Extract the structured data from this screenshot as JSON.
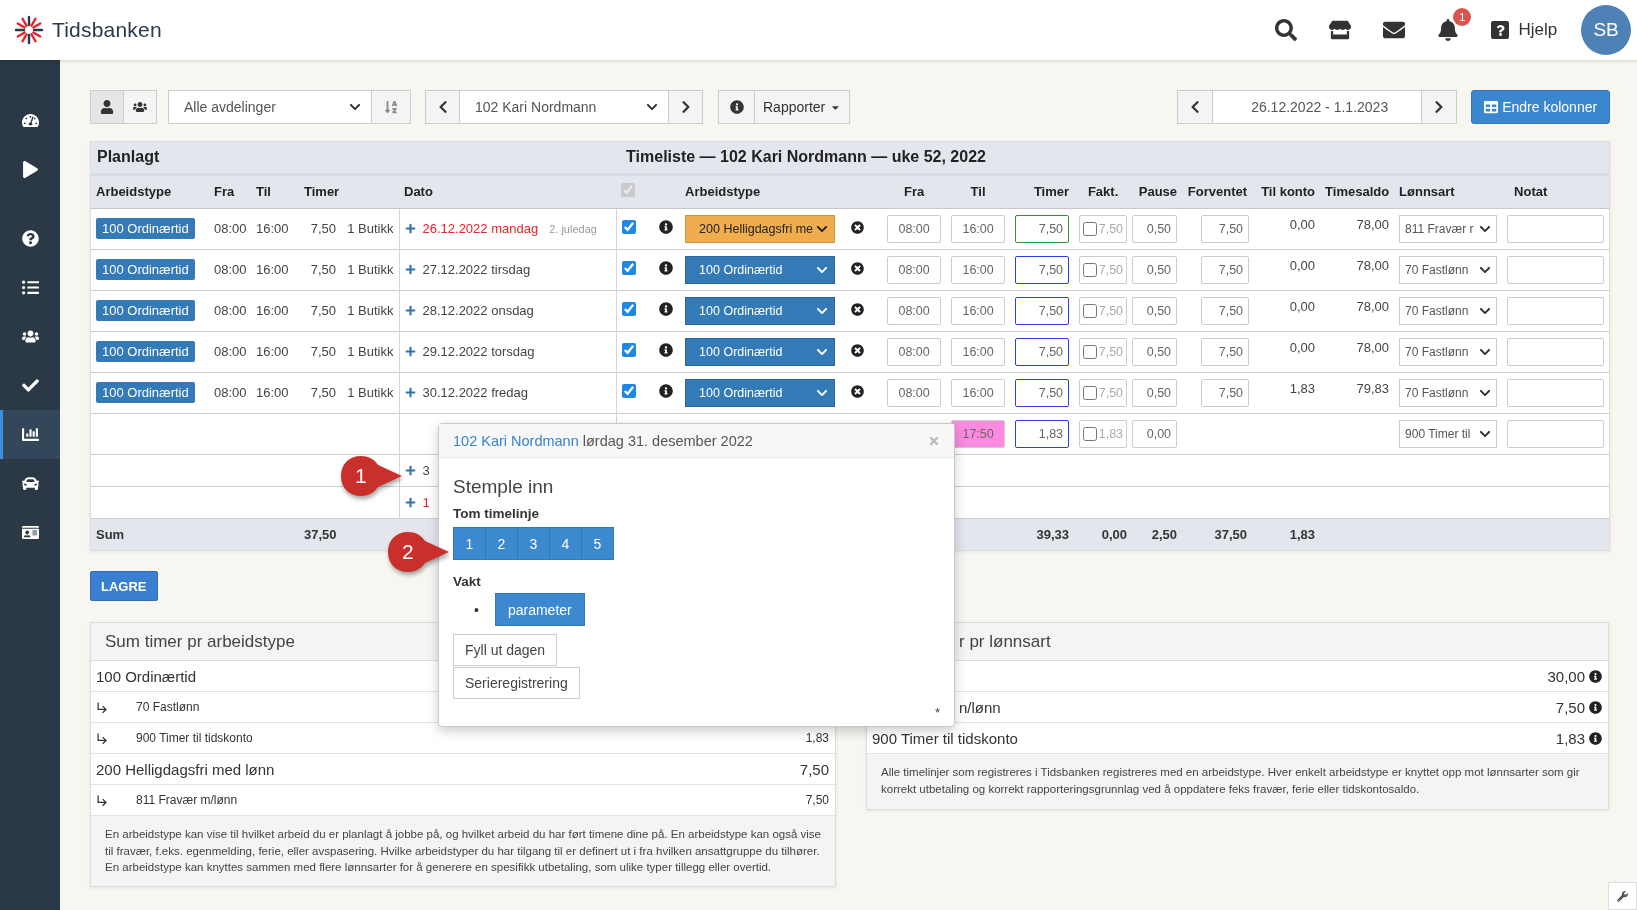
{
  "app": {
    "name": "Tidsbanken"
  },
  "topbar": {
    "notifications": "1",
    "help": "Hjelp",
    "avatar": "SB"
  },
  "sidebar": {
    "items": [
      {
        "selected": false
      },
      {
        "selected": false
      },
      {
        "selected": false
      },
      {
        "selected": false
      },
      {
        "selected": false
      },
      {
        "selected": false
      },
      {
        "selected": true
      },
      {
        "selected": false
      },
      {
        "selected": false
      }
    ]
  },
  "toolbar": {
    "department": "Alle avdelinger",
    "employee": "102 Kari Nordmann",
    "reports": "Rapporter",
    "period": "26.12.2022 - 1.1.2023",
    "columns_button": "Endre kolonner"
  },
  "timesheet": {
    "planned_title": "Planlagt",
    "title": "Timeliste — 102 Kari Nordmann — uke 52, 2022",
    "all_checked": true,
    "columns": [
      "Arbeidstype",
      "Fra",
      "Til",
      "Timer",
      "Dato",
      "Arbeidstype",
      "Fra",
      "Til",
      "Timer",
      "Fakt.",
      "Pause",
      "Forventet",
      "Til konto",
      "Timesaldo",
      "Lønnsart",
      "Notat"
    ],
    "rows": [
      {
        "kind": "full",
        "planned_type": "100 Ordinærtid",
        "planned_from": "08:00",
        "planned_to": "16:00",
        "planned_hours": "7,50",
        "department": "1 Butikk",
        "date": "26.12.2022 mandag",
        "date_note": "2. juledag",
        "holiday": true,
        "checked": true,
        "work_type": "200 Helligdagsfri me",
        "color": "#f0ad4e",
        "from": "08:00",
        "to": "16:00",
        "to_flagged": false,
        "hours": "7,50",
        "hours_confirmed": true,
        "billable_checked": false,
        "billable": "7,50",
        "pause": "0,50",
        "expected": "7,50",
        "to_account": "0,00",
        "balance": "78,00",
        "wage_type": "811 Fravær r"
      },
      {
        "kind": "full",
        "planned_type": "100 Ordinærtid",
        "planned_from": "08:00",
        "planned_to": "16:00",
        "planned_hours": "7,50",
        "department": "1 Butikk",
        "date": "27.12.2022 tirsdag",
        "holiday": false,
        "checked": true,
        "work_type": "100 Ordinærtid",
        "color": "#337ab7",
        "from": "08:00",
        "to": "16:00",
        "to_flagged": false,
        "hours": "7,50",
        "hours_confirmed": false,
        "billable_checked": false,
        "billable": "7,50",
        "pause": "0,50",
        "expected": "7,50",
        "to_account": "0,00",
        "balance": "78,00",
        "wage_type": "70 Fastlønn"
      },
      {
        "kind": "full",
        "planned_type": "100 Ordinærtid",
        "planned_from": "08:00",
        "planned_to": "16:00",
        "planned_hours": "7,50",
        "department": "1 Butikk",
        "date": "28.12.2022 onsdag",
        "holiday": false,
        "checked": true,
        "work_type": "100 Ordinærtid",
        "color": "#337ab7",
        "from": "08:00",
        "to": "16:00",
        "to_flagged": false,
        "hours": "7,50",
        "hours_confirmed": false,
        "billable_checked": false,
        "billable": "7,50",
        "pause": "0,50",
        "expected": "7,50",
        "to_account": "0,00",
        "balance": "78,00",
        "wage_type": "70 Fastlønn"
      },
      {
        "kind": "full",
        "planned_type": "100 Ordinærtid",
        "planned_from": "08:00",
        "planned_to": "16:00",
        "planned_hours": "7,50",
        "department": "1 Butikk",
        "date": "29.12.2022 torsdag",
        "holiday": false,
        "checked": true,
        "work_type": "100 Ordinærtid",
        "color": "#337ab7",
        "from": "08:00",
        "to": "16:00",
        "to_flagged": false,
        "hours": "7,50",
        "hours_confirmed": false,
        "billable_checked": false,
        "billable": "7,50",
        "pause": "0,50",
        "expected": "7,50",
        "to_account": "0,00",
        "balance": "78,00",
        "wage_type": "70 Fastlønn"
      },
      {
        "kind": "full",
        "planned_type": "100 Ordinærtid",
        "planned_from": "08:00",
        "planned_to": "16:00",
        "planned_hours": "7,50",
        "department": "1 Butikk",
        "date": "30.12.2022 fredag",
        "holiday": false,
        "checked": true,
        "work_type": "100 Ordinærtid",
        "color": "#337ab7",
        "from": "08:00",
        "to": "16:00",
        "to_flagged": false,
        "hours": "7,50",
        "hours_confirmed": false,
        "billable_checked": false,
        "billable": "7,50",
        "pause": "0,50",
        "expected": "7,50",
        "to_account": "1,83",
        "balance": "79,83",
        "wage_type": "70 Fastlønn"
      },
      {
        "kind": "covered",
        "to": "17:50",
        "to_flagged": true,
        "hours": "1,83",
        "hours_confirmed": false,
        "billable_checked": false,
        "billable": "1,83",
        "pause": "0,00",
        "wage_type": "900 Timer til"
      },
      {
        "kind": "stub",
        "date": "3",
        "holiday": false
      },
      {
        "kind": "stub",
        "date": "1",
        "holiday": true
      }
    ],
    "sum": {
      "label": "Sum",
      "planned_hours": "37,50",
      "hours": "39,33",
      "billable": "0,00",
      "pause": "2,50",
      "expected": "37,50",
      "to_account": "1,83"
    }
  },
  "save_button": "LAGRE",
  "work_summary": {
    "title": "Sum timer pr arbeidstype",
    "rows": [
      {
        "kind": "type",
        "label": "100 Ordinærtid"
      },
      {
        "kind": "wage",
        "label": "70 Fastlønn"
      },
      {
        "kind": "wage",
        "label": "900 Timer til tidskonto",
        "value": "1,83"
      },
      {
        "kind": "type",
        "label": "200 Helligdagsfri med lønn",
        "value": "7,50"
      },
      {
        "kind": "wage",
        "label": "811 Fravær m/lønn",
        "value": "7,50"
      }
    ],
    "note": "En arbeidstype kan vise til hvilket arbeid du er planlagt å jobbe på, og hvilket arbeid du har ført timene dine på. En arbeidstype kan også vise til fravær, f.eks. egenmelding, ferie, eller avspasering. Hvilke arbeidstyper du har tilgang til er definert ut i fra hvilken ansattgruppe du tilhører. En arbeidstype kan knyttes sammen med flere lønnsarter for å generere en spesifikk utbetaling, som ulike typer tillegg eller overtid."
  },
  "wage_summary": {
    "title": "r pr lønnsart",
    "rows": [
      {
        "value": "30,00"
      },
      {
        "label": "n/lønn",
        "value": "7,50"
      },
      {
        "label": "900 Timer til tidskonto",
        "value": "1,83"
      }
    ],
    "note": "Alle timelinjer som registreres i Tidsbanken registreres med en arbeidstype. Hver enkelt arbeidstype er knyttet opp mot lønnsarter som gir korrekt utbetaling og korrekt rapporteringsgrunnlag ved å oppdatere feks fravær, ferie eller tidskontosaldo."
  },
  "popup": {
    "employee": "102 Kari Nordmann",
    "date": "lørdag 31. desember 2022",
    "title": "Stemple inn",
    "empty_line_label": "Tom timelinje",
    "slots": [
      "1",
      "2",
      "3",
      "4",
      "5"
    ],
    "shift_label": "Vakt",
    "bullet": "•",
    "shifts": [
      "parameter"
    ],
    "actions": [
      "Fyll ut dagen",
      "Serieregistrering"
    ],
    "footnote": "*"
  },
  "markers": [
    {
      "label": "1"
    },
    {
      "label": "2"
    }
  ]
}
